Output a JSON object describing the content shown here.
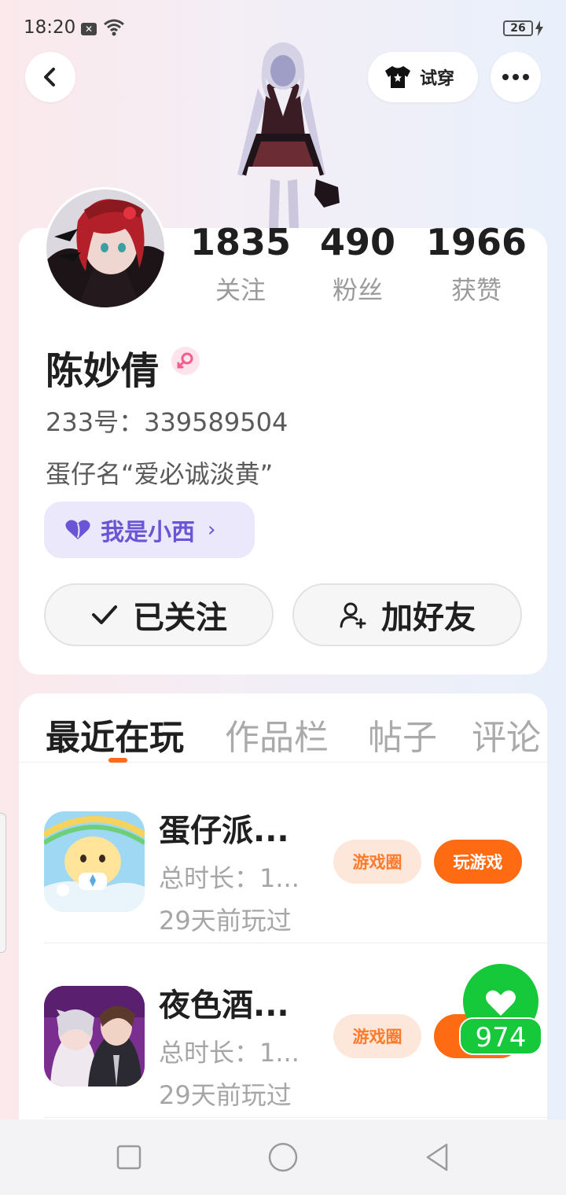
{
  "status": {
    "time": "18:20",
    "battery": "26"
  },
  "header": {
    "tryon_label": "试穿"
  },
  "profile": {
    "name": "陈妙倩",
    "uid": "233号：339589504",
    "bio": "蛋仔名“爱必诚淡黄”",
    "tag": "我是小西",
    "stats": [
      {
        "value": "1835",
        "label": "关注"
      },
      {
        "value": "490",
        "label": "粉丝"
      },
      {
        "value": "1966",
        "label": "获赞"
      }
    ],
    "follow_label": "已关注",
    "add_friend_label": "加好友"
  },
  "tabs": [
    "最近在玩",
    "作品栏",
    "帖子",
    "评论"
  ],
  "games": [
    {
      "title": "蛋仔派...",
      "duration": "总时长：1...",
      "last_played": "29天前玩过",
      "circle_label": "游戏圈",
      "play_label": "玩游戏"
    },
    {
      "title": "夜色酒...",
      "duration": "总时长：1...",
      "last_played": "29天前玩过",
      "circle_label": "游戏圈",
      "play_label": "玩"
    }
  ],
  "like": {
    "count": "974"
  },
  "colors": {
    "accent": "#ff6b12",
    "tag_purple": "#6a55d6",
    "like_green": "#16c93a"
  }
}
